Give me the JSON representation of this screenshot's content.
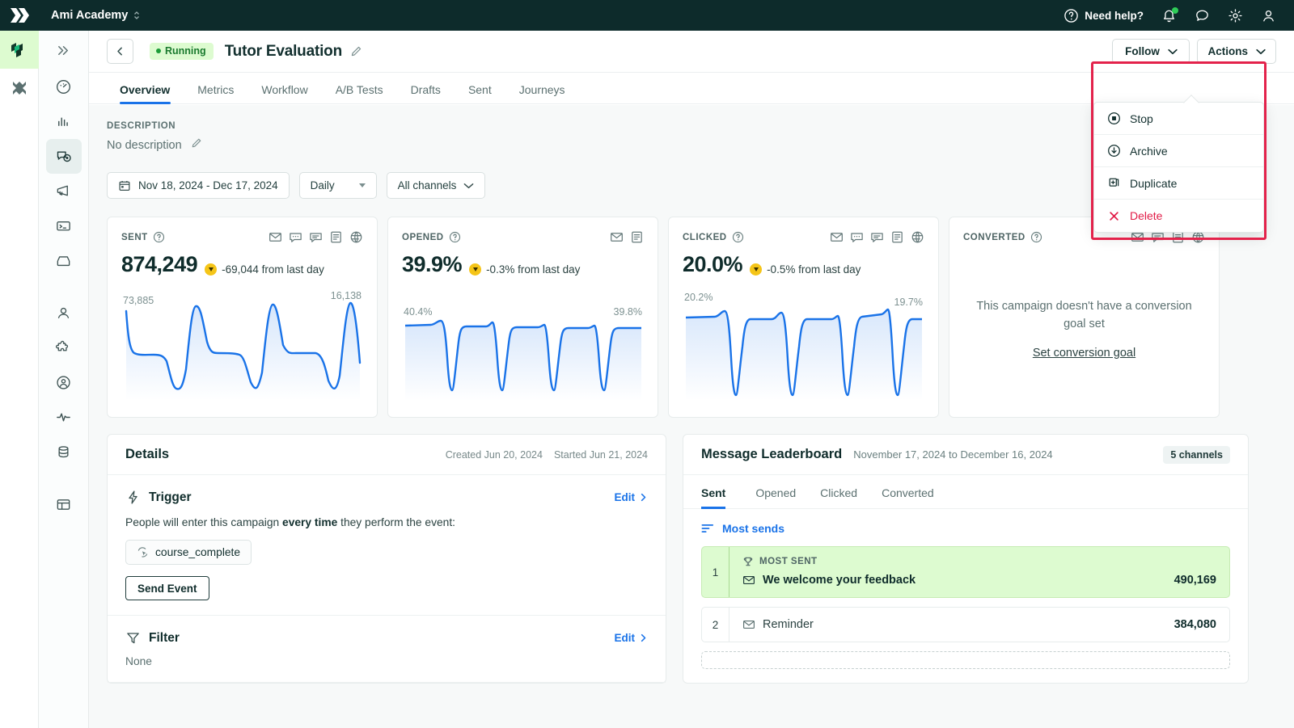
{
  "topbar": {
    "workspace": "Ami Academy",
    "need_help": "Need help?",
    "icons": [
      "help-circle-icon",
      "bell-icon",
      "chat-icon",
      "gear-icon",
      "user-icon"
    ]
  },
  "header": {
    "status": "Running",
    "title": "Tutor Evaluation",
    "follow_label": "Follow",
    "actions_label": "Actions"
  },
  "actions_menu": {
    "items": [
      {
        "label": "Stop",
        "icon": "stop-circle-icon",
        "danger": false
      },
      {
        "label": "Archive",
        "icon": "archive-download-icon",
        "danger": false
      },
      {
        "label": "Duplicate",
        "icon": "duplicate-icon",
        "danger": false
      },
      {
        "label": "Delete",
        "icon": "close-x-icon",
        "danger": true
      }
    ]
  },
  "tabs": [
    {
      "label": "Overview",
      "active": true
    },
    {
      "label": "Metrics",
      "active": false
    },
    {
      "label": "Workflow",
      "active": false
    },
    {
      "label": "A/B Tests",
      "active": false
    },
    {
      "label": "Drafts",
      "active": false
    },
    {
      "label": "Sent",
      "active": false
    },
    {
      "label": "Journeys",
      "active": false
    }
  ],
  "description": {
    "label": "DESCRIPTION",
    "value": "No description"
  },
  "filters": {
    "date_range": "Nov 18, 2024 - Dec 17, 2024",
    "granularity": "Daily",
    "channels": "All channels"
  },
  "cards": [
    {
      "label": "SENT",
      "value": "874,249",
      "delta": "-69,044 from last day",
      "left_label": "73,885",
      "right_label": "16,138",
      "channels": [
        "email-icon",
        "sms-icon",
        "push-icon",
        "in-app-icon",
        "webhook-icon"
      ],
      "empty": false
    },
    {
      "label": "OPENED",
      "value": "39.9%",
      "delta": "-0.3% from last day",
      "left_label": "40.4%",
      "right_label": "39.8%",
      "channels": [
        "email-icon",
        "in-app-icon"
      ],
      "empty": false
    },
    {
      "label": "CLICKED",
      "value": "20.0%",
      "delta": "-0.5% from last day",
      "left_label": "20.2%",
      "right_label": "19.7%",
      "channels": [
        "email-icon",
        "sms-icon",
        "push-icon",
        "in-app-icon",
        "webhook-icon"
      ],
      "empty": false
    },
    {
      "label": "CONVERTED",
      "value": "",
      "delta": "",
      "empty": true,
      "empty_text": "This campaign doesn't have a conversion goal set",
      "empty_link": "Set conversion goal",
      "channels": [
        "email-icon",
        "push-icon",
        "in-app-icon",
        "webhook-icon"
      ]
    }
  ],
  "chart_data": [
    {
      "type": "line",
      "title": "SENT",
      "ylabel": "",
      "annotations": {
        "first": "73,885",
        "last": "16,138"
      },
      "values": [
        73885,
        30000,
        24500,
        24000,
        23800,
        23500,
        12000,
        8000,
        62000,
        26500,
        25500,
        25200,
        25000,
        10500,
        7500,
        70000,
        26000,
        24800,
        24500,
        22000,
        11000,
        7800,
        68000,
        25500,
        25200,
        25800,
        26000,
        10000,
        7200,
        16138
      ]
    },
    {
      "type": "area",
      "title": "OPENED",
      "annotations": {
        "first": "40.4%",
        "last": "39.8%"
      },
      "values": [
        40.4,
        40.3,
        40.2,
        40.2,
        40.1,
        40.5,
        26.0,
        33.0,
        40.3,
        40.2,
        40.2,
        40.3,
        40.5,
        25.5,
        33.5,
        40.2,
        40.2,
        40.1,
        40.1,
        40.0,
        25.0,
        34.0,
        40.1,
        40.2,
        40.2,
        40.1,
        40.0,
        25.2,
        34.5,
        39.8
      ]
    },
    {
      "type": "area",
      "title": "CLICKED",
      "annotations": {
        "first": "20.2%",
        "last": "19.7%"
      },
      "values": [
        20.2,
        20.1,
        20.1,
        20.0,
        20.0,
        20.4,
        11.5,
        16.5,
        20.1,
        20.0,
        20.0,
        20.1,
        20.4,
        11.2,
        16.8,
        20.1,
        20.0,
        20.0,
        20.0,
        20.2,
        11.0,
        17.0,
        20.1,
        20.1,
        20.2,
        20.3,
        20.4,
        11.3,
        17.2,
        19.7
      ]
    }
  ],
  "details": {
    "title": "Details",
    "created": "Created Jun 20, 2024",
    "started": "Started Jun 21, 2024",
    "trigger": {
      "title": "Trigger",
      "edit": "Edit",
      "text_before": "People will enter this campaign ",
      "text_bold": "every time",
      "text_after": " they perform the event:",
      "event": "course_complete",
      "send_event": "Send Event"
    },
    "filter": {
      "title": "Filter",
      "edit": "Edit",
      "value": "None"
    }
  },
  "leaderboard": {
    "title": "Message Leaderboard",
    "subtitle": "November 17, 2024 to December 16, 2024",
    "channels_chip": "5 channels",
    "tabs": [
      {
        "label": "Sent",
        "active": true
      },
      {
        "label": "Opened",
        "active": false
      },
      {
        "label": "Clicked",
        "active": false
      },
      {
        "label": "Converted",
        "active": false
      }
    ],
    "sort_label": "Most sends",
    "rows": [
      {
        "rank": "1",
        "badge": "MOST SENT",
        "name": "We welcome your feedback",
        "value": "490,169",
        "top": true
      },
      {
        "rank": "2",
        "badge": "",
        "name": "Reminder",
        "value": "384,080",
        "top": false
      }
    ]
  },
  "colors": {
    "accent_blue": "#1a73e8",
    "brand_dark": "#0d2b2b",
    "success_green": "#ddfbd0",
    "danger_red": "#e11d48",
    "highlight_red": "#e3224b",
    "warn_yellow": "#f5c518"
  }
}
